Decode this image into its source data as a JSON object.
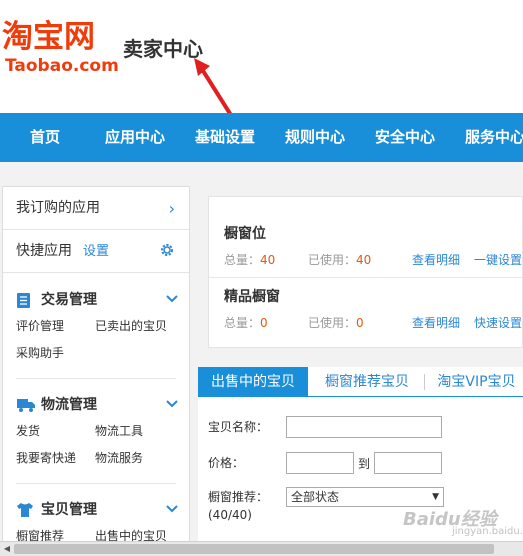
{
  "header": {
    "logo_cn": "淘宝网",
    "logo_en": "Taobao.com",
    "seller_title": "卖家中心"
  },
  "nav": {
    "items": [
      "首页",
      "应用中心",
      "基础设置",
      "规则中心",
      "安全中心",
      "服务中心"
    ]
  },
  "sidebar": {
    "subscribed_apps": "我订购的应用",
    "quick_apps": "快捷应用",
    "settings_link": "设置",
    "sections": [
      {
        "title": "交易管理",
        "icon": "document-list-icon",
        "links": [
          "评价管理",
          "已卖出的宝贝",
          "采购助手"
        ]
      },
      {
        "title": "物流管理",
        "icon": "truck-icon",
        "links": [
          "发货",
          "物流工具",
          "我要寄快递",
          "物流服务"
        ]
      },
      {
        "title": "宝贝管理",
        "icon": "tshirt-icon",
        "links": [
          "橱窗推荐",
          "出售中的宝贝"
        ]
      }
    ]
  },
  "showcase_card": {
    "rows": [
      {
        "title": "橱窗位",
        "total_label": "总量：",
        "total": "40",
        "used_label": "已使用：",
        "used": "40",
        "detail_link": "查看明细",
        "action_link": "一键设置"
      },
      {
        "title": "精品橱窗",
        "total_label": "总量：",
        "total": "0",
        "used_label": "已使用：",
        "used": "0",
        "detail_link": "查看明细",
        "action_link": "快速设置"
      }
    ]
  },
  "tabs": [
    "出售中的宝贝",
    "橱窗推荐宝贝",
    "淘宝VIP宝贝"
  ],
  "active_tab": 0,
  "form": {
    "item_name_label": "宝贝名称：",
    "price_label": "价格：",
    "price_to": "到",
    "showcase_label": "橱窗推荐：",
    "showcase_count": "(40/40)",
    "showcase_select_value": "全部状态"
  },
  "watermark": {
    "text": "Baidu经验",
    "sub": "jingyan.baidu.com"
  },
  "colors": {
    "brand_orange": "#f03c0a",
    "nav_blue": "#1a8fd9",
    "link_blue": "#2b87d3",
    "number_orange": "#e05a16",
    "arrow_red": "#e02020"
  }
}
